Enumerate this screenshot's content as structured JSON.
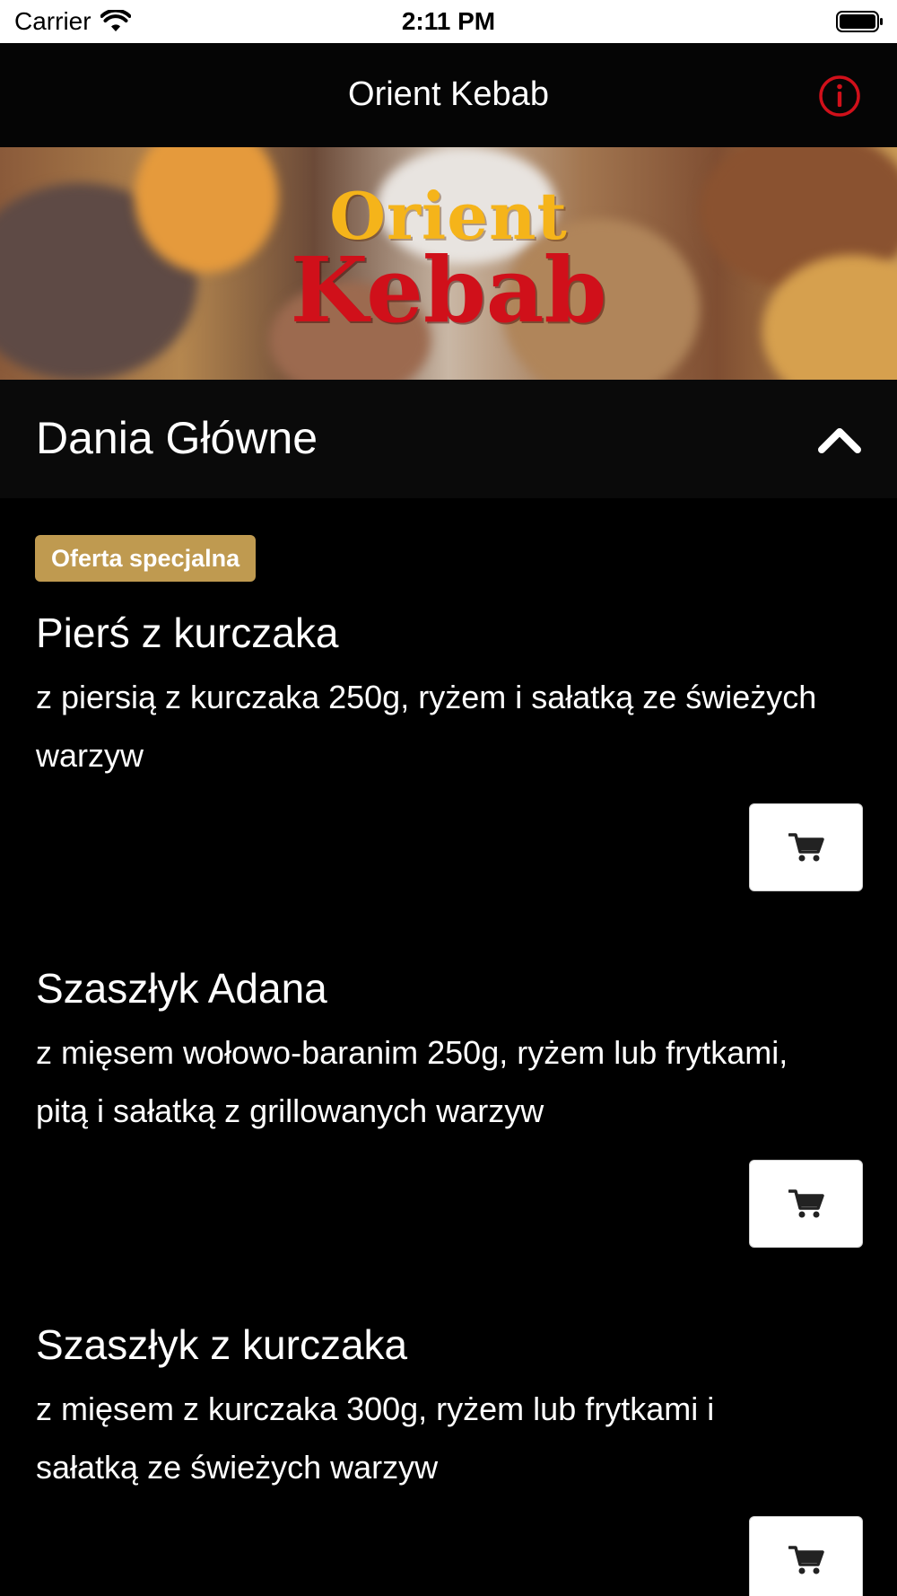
{
  "status_bar": {
    "carrier": "Carrier",
    "time": "2:11 PM"
  },
  "nav": {
    "title": "Orient Kebab",
    "info_icon": "info-circle-icon",
    "accent_color": "#d0101a"
  },
  "banner": {
    "logo_line1": "Orient",
    "logo_line2": "Kebab"
  },
  "section": {
    "title": "Dania Główne",
    "toggle_icon": "chevron-up-icon"
  },
  "colors": {
    "badge": "#bf9a50",
    "background": "#000000"
  },
  "menu": {
    "items": [
      {
        "badge": "Oferta specjalna",
        "name": "Pierś z kurczaka",
        "description": "z piersią z kurczaka 250g, ryżem i sałatką ze świeżych warzyw",
        "cart_icon": "cart-icon"
      },
      {
        "name": "Szaszłyk Adana",
        "description": "z mięsem wołowo-baranim 250g, ryżem lub frytkami, pitą i sałatką z grillowanych warzyw",
        "cart_icon": "cart-icon"
      },
      {
        "name": "Szaszłyk z kurczaka",
        "description": "z mięsem z kurczaka 300g, ryżem lub frytkami i sałatką ze świeżych warzyw",
        "cart_icon": "cart-icon"
      }
    ]
  }
}
